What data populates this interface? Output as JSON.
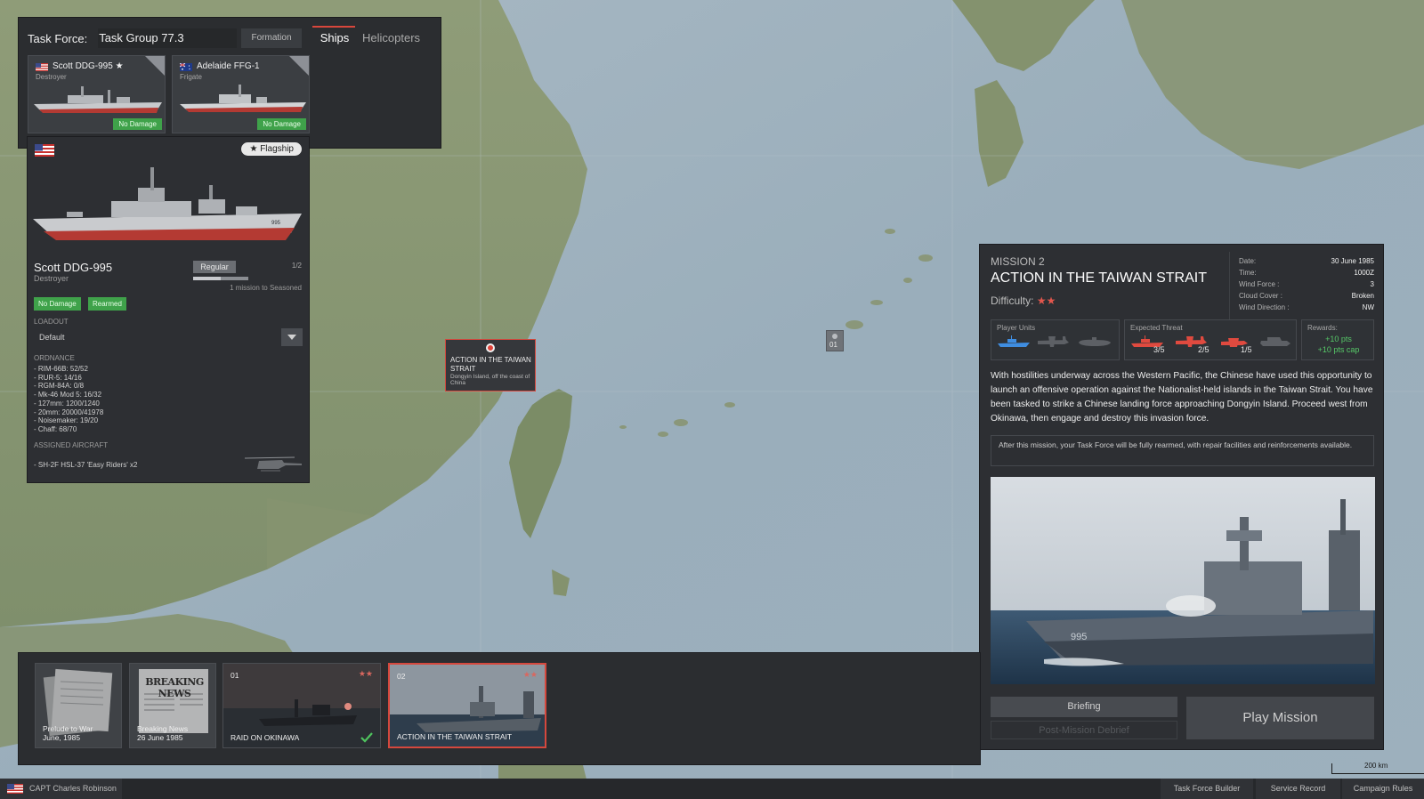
{
  "task_force": {
    "label": "Task Force:",
    "name": "Task Group 77.3",
    "tabs": [
      "Formation",
      "Ships",
      "Helicopters"
    ],
    "ships": [
      {
        "name": "Scott DDG-995 ★",
        "class": "Destroyer",
        "status": "No Damage",
        "flag": "us"
      },
      {
        "name": "Adelaide FFG-1",
        "class": "Frigate",
        "status": "No Damage",
        "flag": "au"
      }
    ]
  },
  "ship_detail": {
    "flagship_label": "★  Flagship",
    "name": "Scott DDG-995",
    "class": "Destroyer",
    "rank": "Regular",
    "rank_count": "1/2",
    "progress_fraction": 0.5,
    "progress_text": "1 mission to Seasoned",
    "badges": [
      "No Damage",
      "Rearmed"
    ],
    "loadout_label": "LOADOUT",
    "loadout_value": "Default",
    "ordnance_label": "ORDNANCE",
    "ordnance": [
      "- RIM-66B: 52/52",
      "- RUR-5: 14/16",
      "- RGM-84A: 0/8",
      "- Mk-46 Mod 5: 16/32",
      "- 127mm: 1200/1240",
      "- 20mm: 20000/41978",
      "- Noisemaker: 19/20",
      "- Chaff: 68/70"
    ],
    "aircraft_label": "ASSIGNED AIRCRAFT",
    "aircraft": "- SH-2F HSL-37 'Easy Riders' x2"
  },
  "map_markers": {
    "main_title": "ACTION IN THE TAIWAN STRAIT",
    "main_subtitle": "Dongyin Island, off the coast of China",
    "secondary_number": "01"
  },
  "mission": {
    "eyebrow": "MISSION 2",
    "title": "ACTION IN THE TAIWAN STRAIT",
    "difficulty_label": "Difficulty:",
    "difficulty_stars": "★★",
    "meta": [
      {
        "k": "Date:",
        "v": "30 June 1985"
      },
      {
        "k": "Time:",
        "v": "1000Z"
      },
      {
        "k": "Wind Force :",
        "v": "3"
      },
      {
        "k": "Cloud Cover :",
        "v": "Broken"
      },
      {
        "k": "Wind Direction :",
        "v": "NW"
      }
    ],
    "player_units_label": "Player Units",
    "threat_label": "Expected Threat",
    "threat_counts": [
      "3/5",
      "2/5",
      "1/5"
    ],
    "rewards_label": "Rewards:",
    "reward_pts": "+10 pts",
    "reward_cap": "+10 pts cap",
    "description": "With hostilities underway across the Western Pacific, the Chinese have used this opportunity to launch an offensive operation against the Nationalist-held islands in the Taiwan Strait. You have been tasked to strike a Chinese landing force approaching Dongyin Island. Proceed west from Okinawa, then engage and destroy this invasion force.",
    "note": "After this mission, your Task Force will be fully rearmed, with repair facilities and reinforcements available.",
    "briefing_label": "Briefing",
    "debrief_label": "Post-Mission Debrief",
    "play_label": "Play Mission"
  },
  "timeline": [
    {
      "caption_l1": "Prelude to War",
      "caption_l2": "June, 1985"
    },
    {
      "caption_l1": "Breaking News",
      "caption_l2": "26 June 1985",
      "headline": "BREAKING NEWS"
    },
    {
      "number": "01",
      "stars": "★★",
      "caption": "RAID ON OKINAWA",
      "completed": true
    },
    {
      "number": "02",
      "stars": "★★",
      "caption": "ACTION IN THE TAIWAN STRAIT",
      "selected": true
    }
  ],
  "bottom_bar": {
    "player": "CAPT Charles Robinson",
    "buttons": [
      "Task Force Builder",
      "Service Record",
      "Campaign Rules"
    ]
  },
  "scale_label": "200 km",
  "colors": {
    "accent_red": "#d5483d",
    "status_green": "#3fa24a",
    "reward_green": "#56c868",
    "panel_bg": "#2d2f33"
  }
}
